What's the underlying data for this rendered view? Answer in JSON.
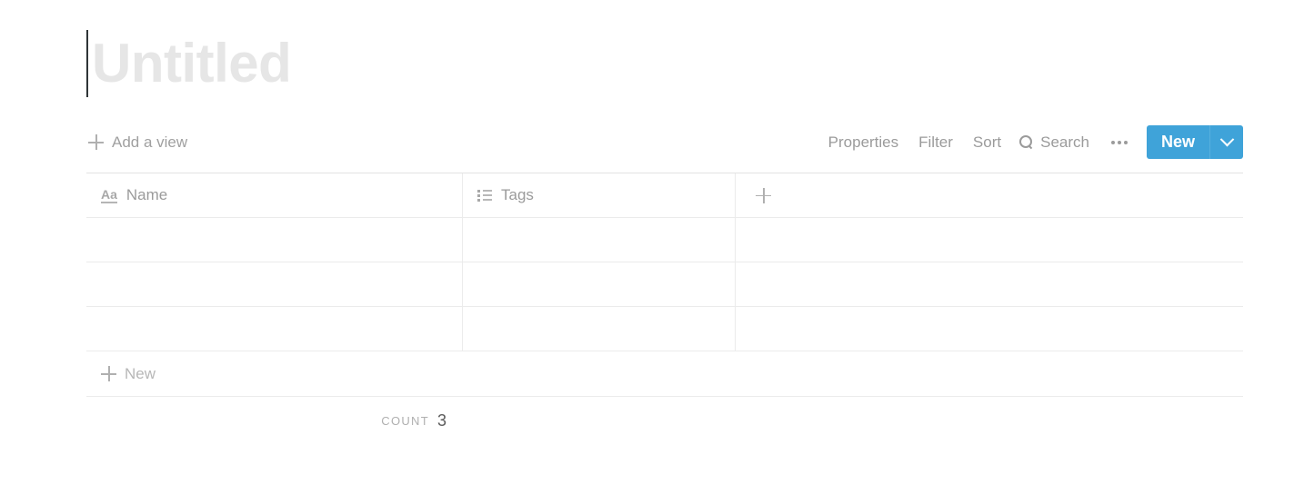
{
  "page": {
    "title_placeholder": "Untitled"
  },
  "toolbar": {
    "add_view_label": "Add a view",
    "add_view_icon": "plus-icon",
    "properties_label": "Properties",
    "filter_label": "Filter",
    "sort_label": "Sort",
    "search_label": "Search",
    "search_icon": "search-icon",
    "more_icon": "ellipsis-icon",
    "new_label": "New",
    "new_caret_icon": "chevron-down-icon",
    "accent_color": "#3fa3d9"
  },
  "table": {
    "columns": [
      {
        "label": "Name",
        "icon": "text-type-icon",
        "type": "title"
      },
      {
        "label": "Tags",
        "icon": "multi-select-icon",
        "type": "multi_select"
      }
    ],
    "add_column_icon": "plus-icon",
    "rows": [
      {
        "name": "",
        "tags": ""
      },
      {
        "name": "",
        "tags": ""
      },
      {
        "name": "",
        "tags": ""
      }
    ],
    "new_row_label": "New",
    "new_row_icon": "plus-icon"
  },
  "footer": {
    "count_label": "COUNT",
    "count_value": "3"
  }
}
